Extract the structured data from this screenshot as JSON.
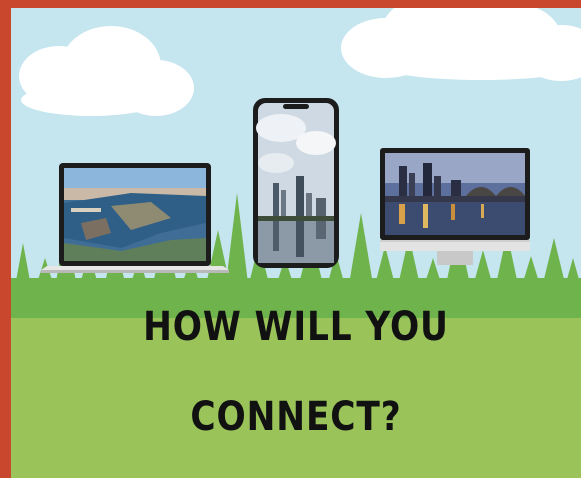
{
  "headline": {
    "line1": "HOW WILL YOU",
    "line2": "CONNECT?"
  },
  "colors": {
    "border": "#c9482d",
    "sky": "#c5e5ef",
    "grass": "#9ac35a",
    "trees": "#6fb34c",
    "text": "#111111"
  },
  "devices": [
    {
      "type": "laptop",
      "screen": "aerial-city-harbor-photo"
    },
    {
      "type": "smartphone",
      "screen": "city-skyline-reflection-photo"
    },
    {
      "type": "desktop-monitor",
      "screen": "city-bridge-night-photo"
    }
  ]
}
